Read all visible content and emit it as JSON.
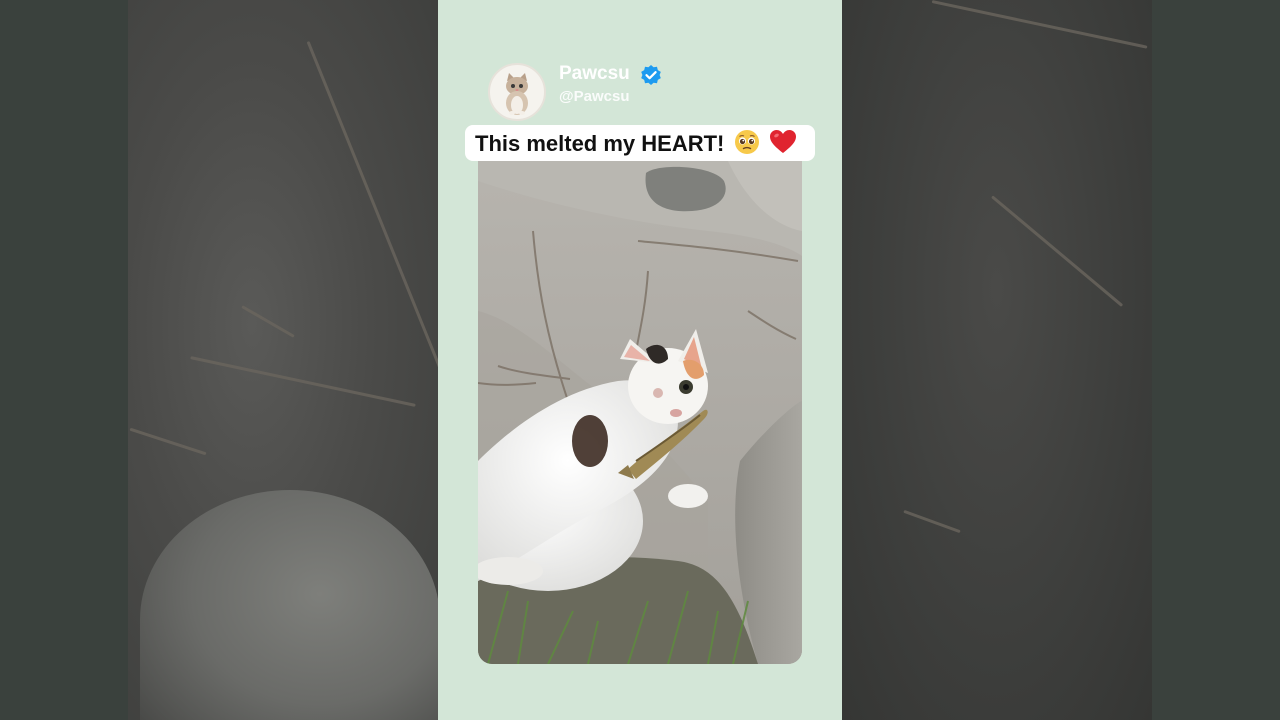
{
  "post": {
    "author_name": "Pawcsu",
    "author_handle": "@Pawcsu",
    "caption": "This melted my HEART!",
    "caption_emojis": [
      "pleading-face",
      "red-heart"
    ]
  },
  "icons": {
    "avatar": "cat-avatar-icon",
    "verified": "verified-badge-icon"
  },
  "colors": {
    "panel_background": "#d3e6d7",
    "verified_blue": "#1d9bf0",
    "caption_background": "#ffffff"
  }
}
